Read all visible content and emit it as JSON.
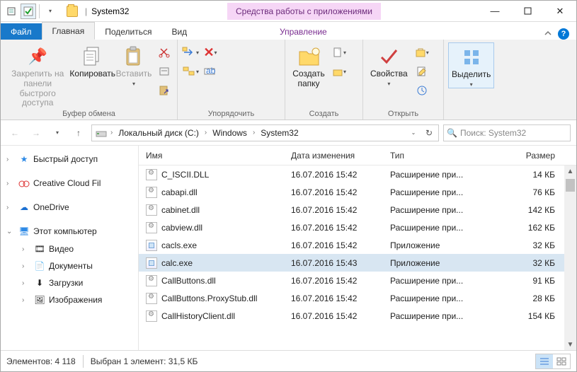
{
  "title": {
    "folder": "System32",
    "context_tab": "Средства работы с приложениями"
  },
  "tabs": {
    "file": "Файл",
    "home": "Главная",
    "share": "Поделиться",
    "view": "Вид",
    "manage": "Управление"
  },
  "ribbon": {
    "pin": "Закрепить на панели\nбыстрого доступа",
    "copy": "Копировать",
    "paste": "Вставить",
    "clipboard_group": "Буфер обмена",
    "organize_group": "Упорядочить",
    "create_folder": "Создать\nпапку",
    "create_group": "Создать",
    "properties": "Свойства",
    "open_group": "Открыть",
    "select": "Выделить"
  },
  "breadcrumb": {
    "drive": "Локальный диск (C:)",
    "p1": "Windows",
    "p2": "System32"
  },
  "search": {
    "placeholder": "Поиск: System32"
  },
  "tree": {
    "quick": "Быстрый доступ",
    "ccf": "Creative Cloud Fil",
    "onedrive": "OneDrive",
    "thispc": "Этот компьютер",
    "video": "Видео",
    "documents": "Документы",
    "downloads": "Загрузки",
    "pictures": "Изображения"
  },
  "columns": {
    "name": "Имя",
    "date": "Дата изменения",
    "type": "Тип",
    "size": "Размер"
  },
  "files": [
    {
      "name": "C_ISCII.DLL",
      "date": "16.07.2016 15:42",
      "type": "Расширение при...",
      "size": "14 КБ",
      "kind": "dll"
    },
    {
      "name": "cabapi.dll",
      "date": "16.07.2016 15:42",
      "type": "Расширение при...",
      "size": "76 КБ",
      "kind": "dll"
    },
    {
      "name": "cabinet.dll",
      "date": "16.07.2016 15:42",
      "type": "Расширение при...",
      "size": "142 КБ",
      "kind": "dll"
    },
    {
      "name": "cabview.dll",
      "date": "16.07.2016 15:42",
      "type": "Расширение при...",
      "size": "162 КБ",
      "kind": "dll"
    },
    {
      "name": "cacls.exe",
      "date": "16.07.2016 15:42",
      "type": "Приложение",
      "size": "32 КБ",
      "kind": "exe"
    },
    {
      "name": "calc.exe",
      "date": "16.07.2016 15:43",
      "type": "Приложение",
      "size": "32 КБ",
      "kind": "exe",
      "selected": true
    },
    {
      "name": "CallButtons.dll",
      "date": "16.07.2016 15:42",
      "type": "Расширение при...",
      "size": "91 КБ",
      "kind": "dll"
    },
    {
      "name": "CallButtons.ProxyStub.dll",
      "date": "16.07.2016 15:42",
      "type": "Расширение при...",
      "size": "28 КБ",
      "kind": "dll"
    },
    {
      "name": "CallHistoryClient.dll",
      "date": "16.07.2016 15:42",
      "type": "Расширение при...",
      "size": "154 КБ",
      "kind": "dll"
    }
  ],
  "status": {
    "count_label": "Элементов:",
    "count": "4 118",
    "sel_label": "Выбран 1 элемент:",
    "sel_size": "31,5 КБ"
  }
}
